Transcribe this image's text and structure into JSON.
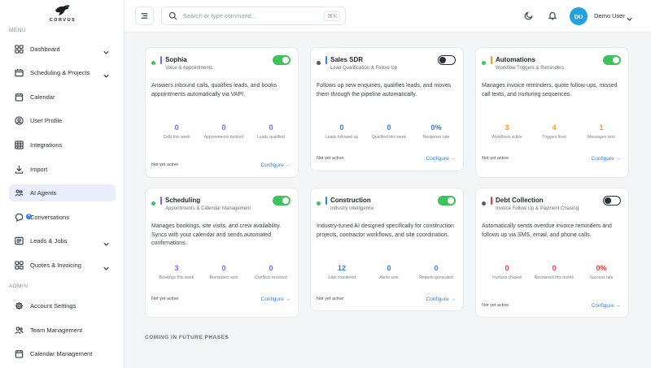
{
  "brand": {
    "name": "CORVUS"
  },
  "sidebar": {
    "menu_label": "MENU",
    "admin_label": "ADMIN",
    "items": [
      {
        "label": "Dashboard",
        "icon": "grid-icon",
        "chevron": true
      },
      {
        "label": "Scheduling & Projects",
        "icon": "folder-icon",
        "chevron": true
      },
      {
        "label": "Calendar",
        "icon": "calendar-icon",
        "chevron": false
      },
      {
        "label": "User Profile",
        "icon": "user-circle-icon",
        "chevron": false
      },
      {
        "label": "Integrations",
        "icon": "table-icon",
        "chevron": false
      },
      {
        "label": "Import",
        "icon": "download-icon",
        "chevron": false
      },
      {
        "label": "AI Agents",
        "icon": "ai-agents-icon",
        "chevron": false,
        "active": true
      },
      {
        "label": "Conversations",
        "icon": "chat-icon",
        "chevron": false,
        "badge": "4"
      },
      {
        "label": "Leads & Jobs",
        "icon": "list-icon",
        "chevron": true
      },
      {
        "label": "Quotes & Invoicing",
        "icon": "grid-icon",
        "chevron": true
      }
    ],
    "admin_items": [
      {
        "label": "Account Settings",
        "icon": "gear-icon"
      },
      {
        "label": "Team Management",
        "icon": "users-icon"
      },
      {
        "label": "Calendar Management",
        "icon": "calendar-icon"
      }
    ]
  },
  "topbar": {
    "search_placeholder": "Search or type command...",
    "shortcut": "⌘K",
    "avatar_initials": "DU",
    "user_name": "Demo User"
  },
  "colors": {
    "green": "#3ec25b",
    "blue": "#2f80ed",
    "purple": "#8b5cf6",
    "orange": "#f59e0b",
    "red": "#e53935"
  },
  "cards": [
    {
      "title": "Sophia",
      "subtitle": "Voice & Appointments",
      "accent": "#8b5cf6",
      "enabled": true,
      "description": "Answers inbound calls, qualifies leads, and books appointments automatically via VAPI.",
      "metric_color": "#8b5cf6",
      "metrics": [
        {
          "value": "0",
          "label": "Calls this week"
        },
        {
          "value": "0",
          "label": "Appointments booked"
        },
        {
          "value": "0",
          "label": "Leads qualified"
        }
      ],
      "status": "Not yet active",
      "link": "Configure →"
    },
    {
      "title": "Sales SDR",
      "subtitle": "Lead Qualification & Follow Up",
      "accent": "#2f80ed",
      "enabled": false,
      "description": "Follows up new enquiries, qualifies leads, and moves them through the pipeline automatically.",
      "metric_color": "#2f80ed",
      "metrics": [
        {
          "value": "0",
          "label": "Leads followed up"
        },
        {
          "value": "0",
          "label": "Qualified this week"
        },
        {
          "value": "0%",
          "label": "Response rate"
        }
      ],
      "status": "Not yet active",
      "link": "Configure →"
    },
    {
      "title": "Automations",
      "subtitle": "Workflow Triggers & Reminders",
      "accent": "#f59e0b",
      "enabled": true,
      "description": "Manages invoice reminders, quote follow-ups, missed call texts, and nurturing sequences.",
      "metric_color": "#f59e0b",
      "metrics": [
        {
          "value": "3",
          "label": "Workflows active"
        },
        {
          "value": "4",
          "label": "Triggers fired"
        },
        {
          "value": "1",
          "label": "Messages sent"
        }
      ],
      "status": "Not yet active",
      "link": "Configure →"
    },
    {
      "title": "Scheduling",
      "subtitle": "Appointments & Calendar Management",
      "accent": "#8b5cf6",
      "enabled": true,
      "description": "Manages bookings, site visits, and crew availability. Syncs with your calendar and sends automated confirmations.",
      "metric_color": "#8b5cf6",
      "metrics": [
        {
          "value": "3",
          "label": "Bookings this week"
        },
        {
          "value": "0",
          "label": "Reminders sent"
        },
        {
          "value": "0",
          "label": "Conflicts resolved"
        }
      ],
      "status": "Not yet active",
      "link": "Configure →"
    },
    {
      "title": "Construction",
      "subtitle": "Industry Intelligence",
      "accent": "#2f80ed",
      "enabled": true,
      "description": "Industry-tuned AI designed specifically for construction projects, contractor workflows, and site coordination.",
      "metric_color": "#2f80ed",
      "metrics": [
        {
          "value": "12",
          "label": "Jobs monitored"
        },
        {
          "value": "0",
          "label": "Alerts sent"
        },
        {
          "value": "0",
          "label": "Reports generated"
        }
      ],
      "status": "Not yet active",
      "link": "Configure →"
    },
    {
      "title": "Debt Collection",
      "subtitle": "Invoice Follow Up & Payment Chasing",
      "accent": "#e53935",
      "enabled": false,
      "description": "Automatically sends overdue invoice reminders and follows up via SMS, email, and phone calls.",
      "metric_color": "#e53935",
      "metrics": [
        {
          "value": "0",
          "label": "Invoices chased"
        },
        {
          "value": "0",
          "label": "Recovered this month"
        },
        {
          "value": "0%",
          "label": "Success rate"
        }
      ],
      "status": "Not yet active",
      "link": "Configure →"
    }
  ],
  "future_heading": "COMING IN FUTURE PHASES"
}
